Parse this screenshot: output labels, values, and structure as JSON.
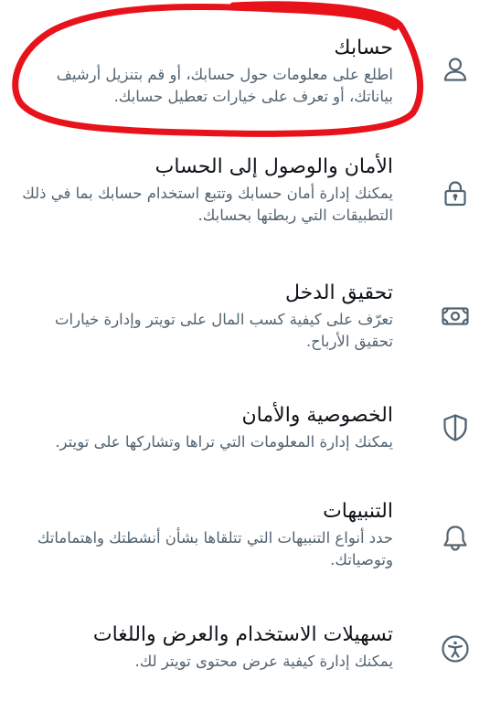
{
  "settings": {
    "items": [
      {
        "title": "حسابك",
        "desc": "اطلع على معلومات حول حسابك، أو قم بتنزيل أرشيف بياناتك، أو تعرف على خيارات تعطيل حسابك.",
        "icon": "person-icon"
      },
      {
        "title": "الأمان والوصول إلى الحساب",
        "desc": "يمكنك إدارة أمان حسابك وتتبع استخدام حسابك بما في ذلك التطبيقات التي ربطتها بحسابك.",
        "icon": "lock-icon"
      },
      {
        "title": "تحقيق الدخل",
        "desc": "تعرّف على كيفية كسب المال على تويتر وإدارة خيارات تحقيق الأرباح.",
        "icon": "money-icon"
      },
      {
        "title": "الخصوصية والأمان",
        "desc": "يمكنك إدارة المعلومات التي تراها وتشاركها على تويتر.",
        "icon": "shield-icon"
      },
      {
        "title": "التنبيهات",
        "desc": "حدد أنواع التنبيهات التي تتلقاها بشأن أنشطتك واهتماماتك وتوصياتك.",
        "icon": "bell-icon"
      },
      {
        "title": "تسهيلات الاستخدام والعرض واللغات",
        "desc": "يمكنك إدارة كيفية عرض محتوى تويتر لك.",
        "icon": "accessibility-icon"
      }
    ]
  },
  "annotation": {
    "color": "#e8121b"
  }
}
